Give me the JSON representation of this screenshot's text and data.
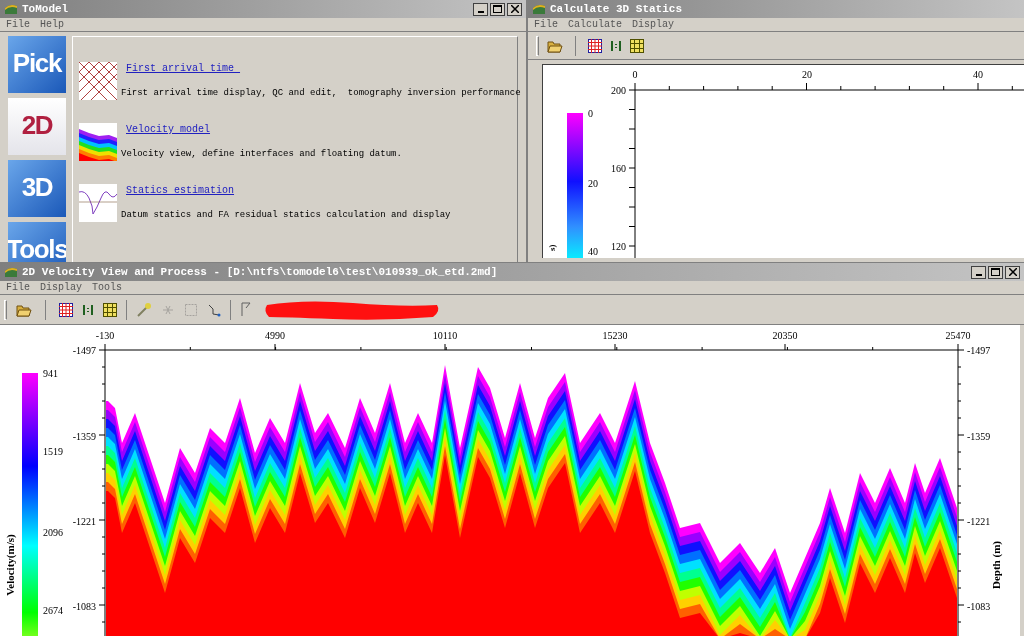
{
  "tomodel_window": {
    "title": "ToModel",
    "menu": [
      "File",
      "Help"
    ],
    "modules": [
      {
        "label": "Pick",
        "kind": "blue"
      },
      {
        "label": "2D",
        "kind": "white"
      },
      {
        "label": "3D",
        "kind": "blue"
      },
      {
        "label": "Tools",
        "kind": "blue"
      }
    ],
    "entries": [
      {
        "link": "First arrival time ",
        "description": "First arrival time display, QC and edit,  tomography inversion performance"
      },
      {
        "link": "Velocity model",
        "description": "Velocity view, define interfaces and floating datum."
      },
      {
        "link": "Statics estimation",
        "description": "Datum statics and FA residual statics calculation and display"
      }
    ]
  },
  "statics_window": {
    "title": "Calculate 3D Statics",
    "menu": [
      "File",
      "Calculate",
      "Display"
    ],
    "x_ticks": [
      "0",
      "20",
      "40"
    ],
    "y_ticks": [
      "200",
      "160",
      "120"
    ],
    "colorbar_ticks": [
      "0",
      "20",
      "40"
    ],
    "colorbar_label": "s)"
  },
  "velocity_window": {
    "title": "2D Velocity View and Process - [D:\\ntfs\\tomodel6\\test\\010939_ok_etd.2md]",
    "menu": [
      "File",
      "Display",
      "Tools"
    ],
    "x_ticks": [
      "-130",
      "4990",
      "10110",
      "15230",
      "20350",
      "25470"
    ],
    "left_y_ticks": [
      "-1497",
      "-1359",
      "-1221",
      "-1083"
    ],
    "right_y_ticks": [
      "-1497",
      "-1359",
      "-1221",
      "-1083"
    ],
    "colorbar_ticks": [
      "941",
      "1519",
      "2096",
      "2674"
    ],
    "colorbar_label": "Velocity(m/s)",
    "depth_label": "Depth (m)"
  }
}
